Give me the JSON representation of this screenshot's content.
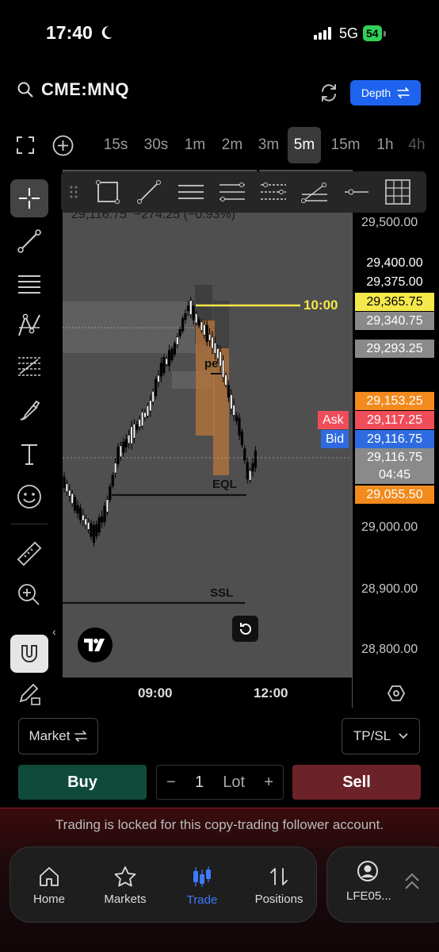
{
  "status_bar": {
    "time": "17:40",
    "network": "5G",
    "battery": "54"
  },
  "header": {
    "symbol": "CME:MNQ",
    "depth_label": "Depth"
  },
  "timeframes": [
    {
      "label": "15s",
      "active": false
    },
    {
      "label": "30s",
      "active": false
    },
    {
      "label": "1m",
      "active": false
    },
    {
      "label": "2m",
      "active": false
    },
    {
      "label": "3m",
      "active": false
    },
    {
      "label": "5m",
      "active": true
    },
    {
      "label": "15m",
      "active": false
    },
    {
      "label": "1h",
      "active": false
    },
    {
      "label": "4h",
      "active": false
    }
  ],
  "chart": {
    "ohlc_readout": "29,116.75  −274.25 (−0.93%)",
    "session_label": "10:00",
    "annotations": {
      "eql": "EQL",
      "ssl": "SSL",
      "box_label": "pe"
    },
    "price_scale": [
      "29,500.00",
      "29,000.00",
      "28,900.00",
      "28,800.00"
    ],
    "price_tags": [
      {
        "value": "29,400.00",
        "bg": "#000000",
        "fg": "#ffffff"
      },
      {
        "value": "29,375.00",
        "bg": "#000000",
        "fg": "#ffffff"
      },
      {
        "value": "29,365.75",
        "bg": "#f5e84a",
        "fg": "#000000"
      },
      {
        "value": "29,340.75",
        "bg": "#8a8a8a",
        "fg": "#ffffff"
      },
      {
        "value": "29,293.25",
        "bg": "#8a8a8a",
        "fg": "#ffffff"
      },
      {
        "value": "29,153.25",
        "bg": "#f28a1e",
        "fg": "#ffffff"
      },
      {
        "value": "29,117.25",
        "bg": "#f04d5a",
        "fg": "#ffffff"
      },
      {
        "value": "29,116.75",
        "bg": "#2f6be0",
        "fg": "#ffffff"
      },
      {
        "value": "29,116.75",
        "bg": "#8a8a8a",
        "fg": "#ffffff"
      },
      {
        "value": "29,055.50",
        "bg": "#f28a1e",
        "fg": "#ffffff"
      }
    ],
    "ask_label": "Ask",
    "bid_label": "Bid",
    "countdown": "04:45",
    "time_labels": [
      "09:00",
      "12:00"
    ]
  },
  "order": {
    "order_type": "Market",
    "tpsl": "TP/SL",
    "buy": "Buy",
    "sell": "Sell",
    "quantity": "1",
    "unit": "Lot"
  },
  "locked_message": "Trading is locked for this copy-trading follower account.",
  "nav": {
    "items": [
      {
        "label": "Home",
        "icon": "home-icon"
      },
      {
        "label": "Markets",
        "icon": "star-icon"
      },
      {
        "label": "Trade",
        "icon": "candles-icon"
      },
      {
        "label": "Positions",
        "icon": "swap-icon"
      }
    ],
    "active": "Trade",
    "account": "LFE05..."
  },
  "colors": {
    "accent": "#1e63ee",
    "buy": "#0f4a3b",
    "sell": "#6b2228",
    "session_line": "#f5e84a"
  }
}
